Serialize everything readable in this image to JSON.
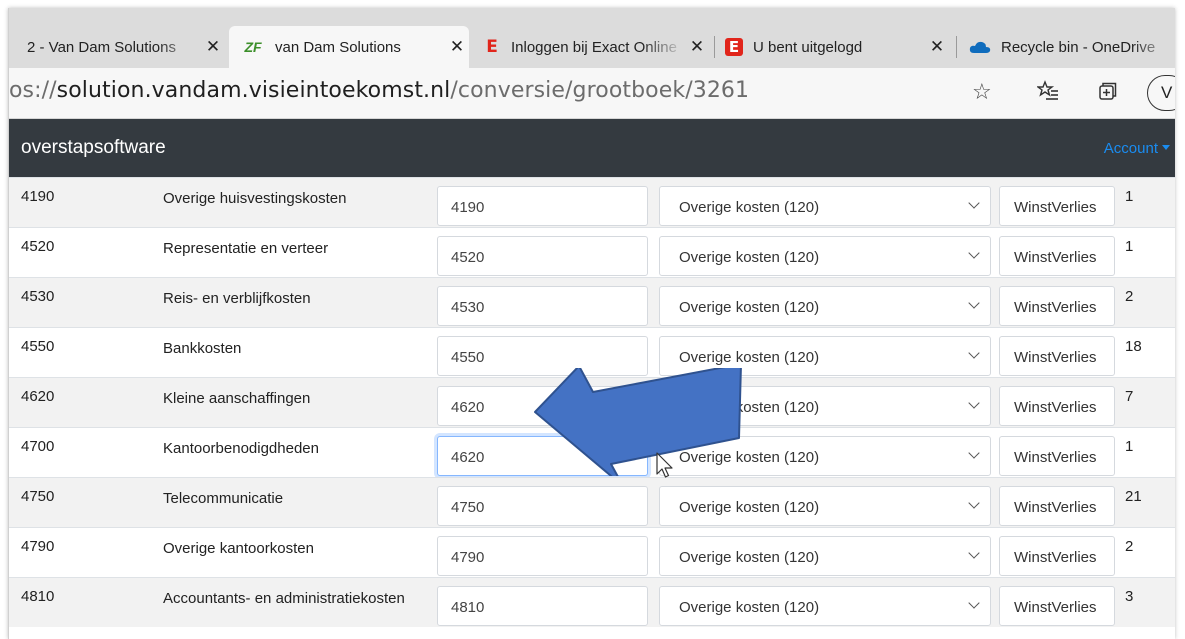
{
  "tabs": [
    {
      "title": "2 - Van Dam Solutions",
      "favicon": "none",
      "active": false,
      "close": "✕"
    },
    {
      "title": "van Dam Solutions",
      "favicon": "zf-logo-icon",
      "favicon_text": "ZF",
      "active": true,
      "close": "✕"
    },
    {
      "title": "Inloggen bij Exact Online",
      "favicon": "exact-icon",
      "favicon_text": "E",
      "active": false,
      "close": "✕"
    },
    {
      "title": "U bent uitgelogd",
      "favicon": "exact-icon",
      "favicon_text": "E",
      "active": false,
      "close": "✕"
    },
    {
      "title": "Recycle bin - OneDrive",
      "favicon": "onedrive-icon",
      "active": false
    }
  ],
  "address": {
    "prefix": "os://",
    "host": "solution.vandam.visieintoekomst.nl",
    "path": "/conversie/grootboek/3261",
    "profile_letter": "V"
  },
  "navbar": {
    "brand": "overstapsoftware",
    "account": "Account"
  },
  "rows": [
    {
      "code": "4190",
      "name": "Overige huisvestingskosten",
      "input": "4190",
      "category": "Overige kosten (120)",
      "type": "WinstVerlies",
      "count": "1"
    },
    {
      "code": "4520",
      "name": "Representatie en verteer",
      "input": "4520",
      "category": "Overige kosten (120)",
      "type": "WinstVerlies",
      "count": "1"
    },
    {
      "code": "4530",
      "name": "Reis- en verblijfkosten",
      "input": "4530",
      "category": "Overige kosten (120)",
      "type": "WinstVerlies",
      "count": "2"
    },
    {
      "code": "4550",
      "name": "Bankkosten",
      "input": "4550",
      "category": "Overige kosten (120)",
      "type": "WinstVerlies",
      "count": "18"
    },
    {
      "code": "4620",
      "name": "Kleine aanschaffingen",
      "input": "4620",
      "category": "Overige kosten (120)",
      "type": "WinstVerlies",
      "count": "7"
    },
    {
      "code": "4700",
      "name": "Kantoorbenodigdheden",
      "input": "4620",
      "category": "Overige kosten (120)",
      "type": "WinstVerlies",
      "count": "1",
      "focused": true
    },
    {
      "code": "4750",
      "name": "Telecommunicatie",
      "input": "4750",
      "category": "Overige kosten (120)",
      "type": "WinstVerlies",
      "count": "21"
    },
    {
      "code": "4790",
      "name": "Overige kantoorkosten",
      "input": "4790",
      "category": "Overige kosten (120)",
      "type": "WinstVerlies",
      "count": "2"
    },
    {
      "code": "4810",
      "name": "Accountants- en administratiekosten",
      "input": "4810",
      "category": "Overige kosten (120)",
      "type": "WinstVerlies",
      "count": "3"
    }
  ],
  "colors": {
    "navbar_bg": "#343a40",
    "account_link": "#1a8cf0",
    "arrow_fill": "#4472c4",
    "arrow_stroke": "#2f528f",
    "exact_red": "#e1251b"
  }
}
